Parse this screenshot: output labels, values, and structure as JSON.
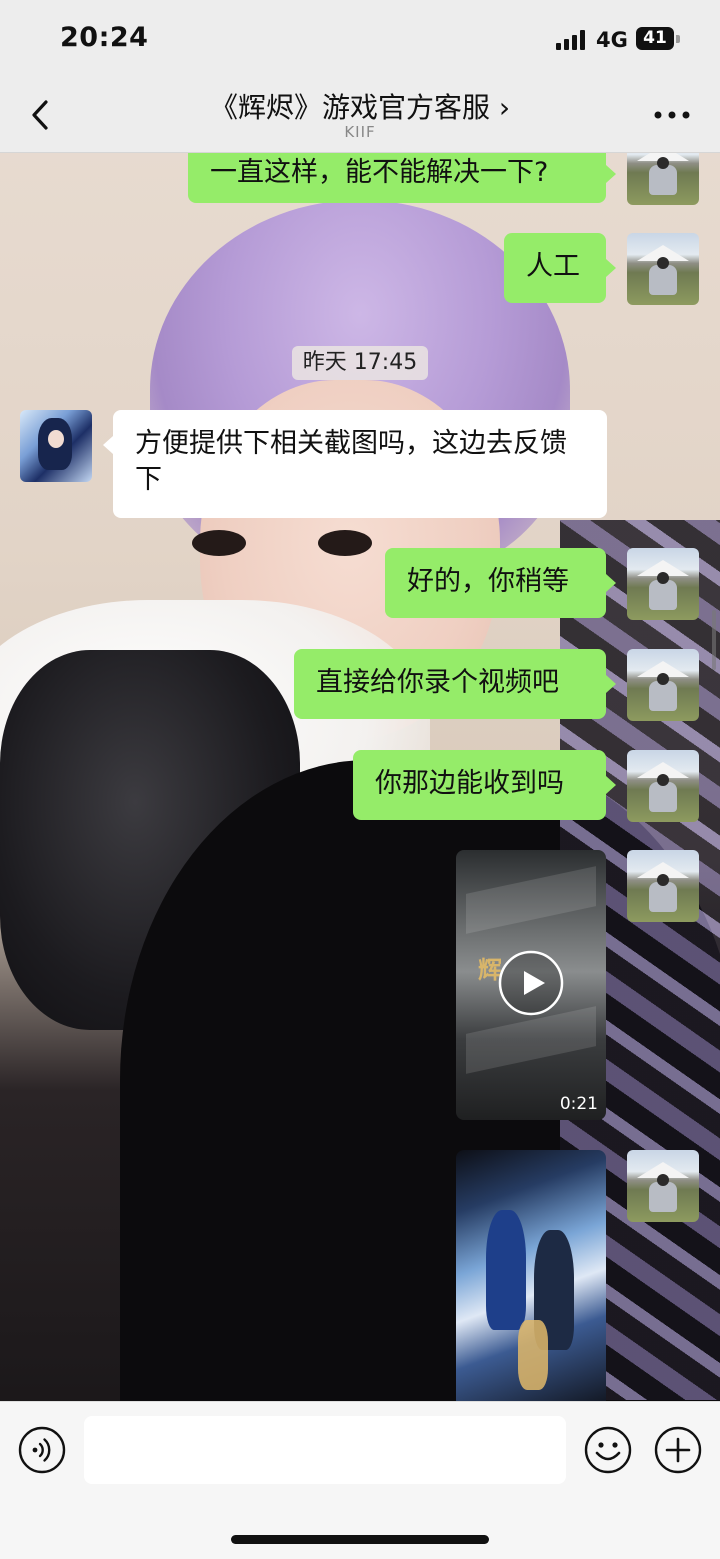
{
  "status_bar": {
    "time": "20:24",
    "network": "4G",
    "battery": "41"
  },
  "nav": {
    "title": "《辉烬》游戏官方客服 ›",
    "subtitle": "KIIF",
    "back_icon": "chevron-left-icon",
    "more_icon": "more-dots-icon"
  },
  "chat": {
    "timestamp": "昨天 17:45",
    "messages": [
      {
        "from": "me",
        "type": "text",
        "text": "一直这样，能不能解决一下?"
      },
      {
        "from": "me",
        "type": "text",
        "text": "人工"
      },
      {
        "from": "them",
        "type": "text",
        "text": "方便提供下相关截图吗，这边去反馈下"
      },
      {
        "from": "me",
        "type": "text",
        "text": "好的，你稍等"
      },
      {
        "from": "me",
        "type": "text",
        "text": "直接给你录个视频吧"
      },
      {
        "from": "me",
        "type": "text",
        "text": "你那边能收到吗"
      },
      {
        "from": "me",
        "type": "video",
        "duration": "0:21"
      },
      {
        "from": "me",
        "type": "image"
      }
    ]
  },
  "input_bar": {
    "placeholder": "",
    "voice_icon": "voice-icon",
    "emoji_icon": "emoji-icon",
    "plus_icon": "plus-icon"
  },
  "colors": {
    "my_bubble": "#95ec69",
    "their_bubble": "#ffffff",
    "bar_bg": "#ededed"
  }
}
